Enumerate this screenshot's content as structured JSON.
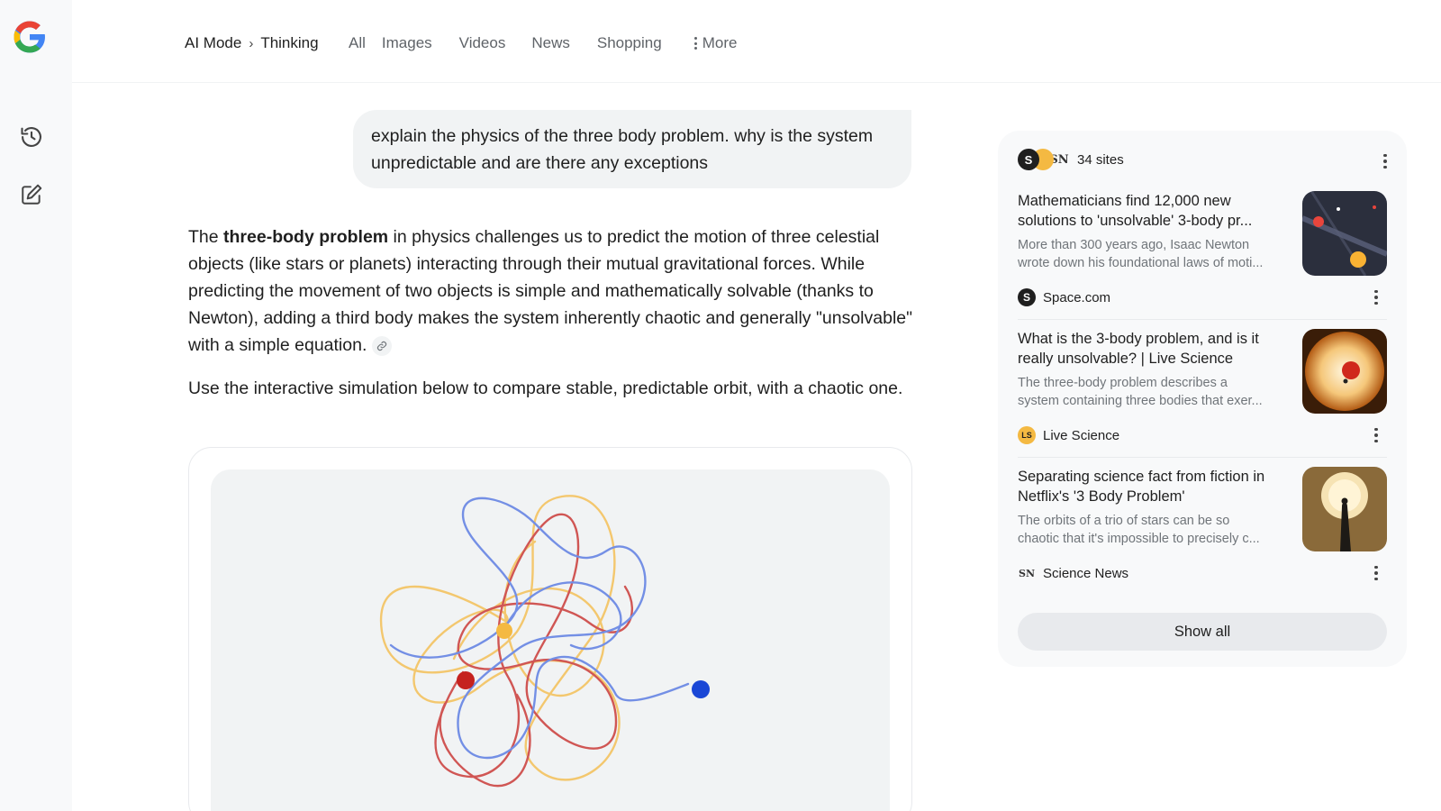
{
  "rail": {
    "logo_icon": "google-g-logo",
    "history_icon": "history-icon",
    "new_chat_icon": "edit-icon"
  },
  "nav": {
    "breadcrumb_root": "AI Mode",
    "breadcrumb_current": "Thinking",
    "tabs": [
      "All",
      "Images",
      "Videos",
      "News",
      "Shopping"
    ],
    "more_label": "More"
  },
  "query": {
    "text": "explain the physics of the three body problem. why is the system unpredictable and are there any exceptions"
  },
  "answer": {
    "p1_prefix": "The ",
    "p1_bold": "three-body problem",
    "p1_rest": " in physics challenges us to predict the motion of three celestial objects (like stars or planets) interacting through their mutual gravitational forces. While predicting the movement of two objects is simple and mathematically solvable (thanks to Newton), adding a third body makes the system inherently chaotic and generally \"unsolvable\" with a simple equation.",
    "p2": "Use the interactive simulation below to compare stable, predictable orbit, with a chaotic one."
  },
  "simulation": {
    "colors": {
      "yellow": "#f4b942",
      "red": "#c5221f",
      "blue": "#1a47d6"
    }
  },
  "sources": {
    "count_label": "34 sites",
    "items": [
      {
        "title": "Mathematicians find 12,000 new solutions to 'unsolvable' 3-body pr...",
        "snippet_line1": "More than 300 years ago, Isaac Newton",
        "snippet_line2": "wrote down his foundational laws of moti...",
        "site": "Space.com",
        "favicon": "S"
      },
      {
        "title": "What is the 3-body problem, and is it really unsolvable? | Live Science",
        "snippet_line1": "The three-body problem describes a",
        "snippet_line2": "system containing three bodies that exer...",
        "site": "Live Science",
        "favicon": "LS"
      },
      {
        "title": "Separating science fact from fiction in Netflix's '3 Body Problem'",
        "snippet_line1": "The orbits of a trio of stars can be so",
        "snippet_line2": "chaotic that it's impossible to precisely c...",
        "site": "Science News",
        "favicon": "SN"
      }
    ],
    "show_all_label": "Show all"
  }
}
